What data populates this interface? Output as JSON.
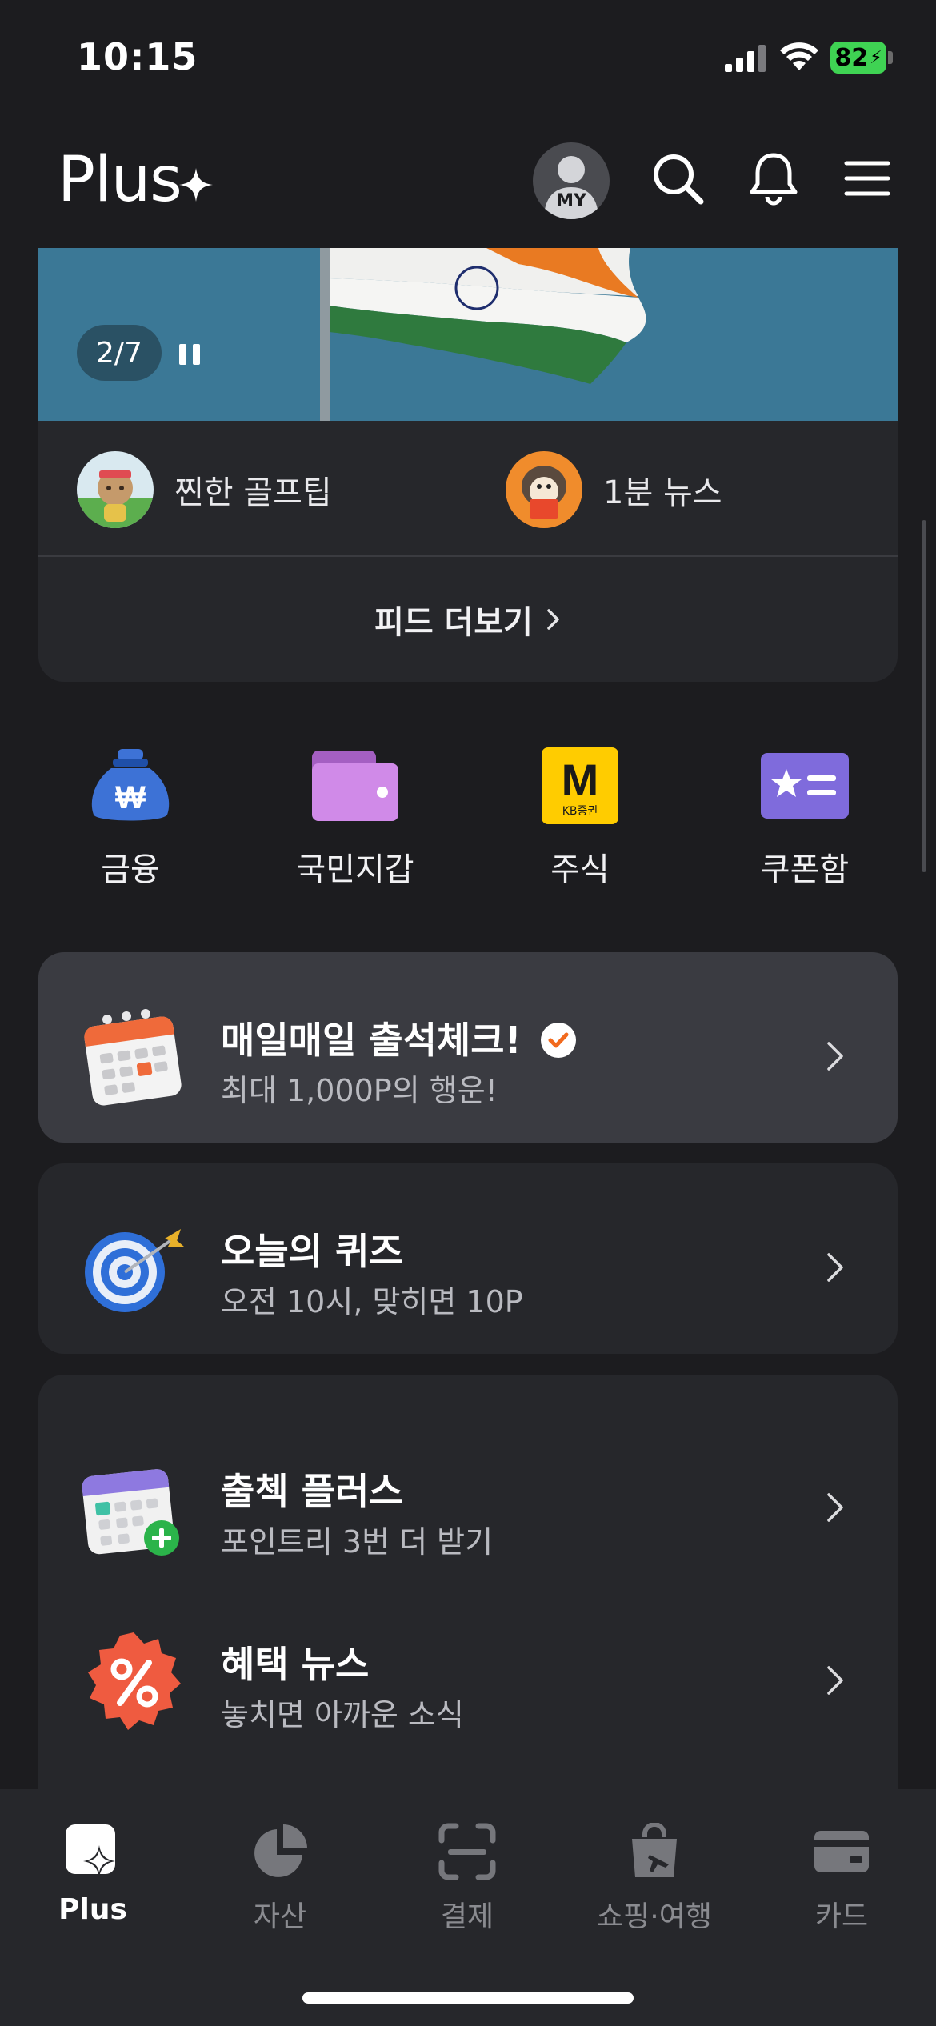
{
  "status_bar": {
    "time": "10:15",
    "battery": "82"
  },
  "header": {
    "logo": "Plus",
    "avatar_label": "MY"
  },
  "feed": {
    "pager": "2/7",
    "items": [
      {
        "label": "찐한 골프팁"
      },
      {
        "label": "1분 뉴스"
      }
    ],
    "more_label": "피드 더보기"
  },
  "quick_menu": [
    {
      "label": "금융"
    },
    {
      "label": "국민지갑"
    },
    {
      "label": "주식"
    },
    {
      "label": "쿠폰함"
    }
  ],
  "stock_icon_text": {
    "big": "M",
    "small": "KB증권"
  },
  "rows": {
    "attendance": {
      "title": "매일매일 출석체크!",
      "sub": "최대 1,000P의 행운!"
    },
    "quiz": {
      "title": "오늘의 퀴즈",
      "sub": "오전 10시, 맞히면 10P"
    },
    "checkplus": {
      "title": "출첵 플러스",
      "sub": "포인트리 3번 더 받기"
    },
    "benefit": {
      "title": "혜택 뉴스",
      "sub": "놓치면 아까운 소식"
    }
  },
  "tabs": [
    {
      "label": "Plus"
    },
    {
      "label": "자산"
    },
    {
      "label": "결제"
    },
    {
      "label": "쇼핑·여행"
    },
    {
      "label": "카드"
    }
  ],
  "colors": {
    "background": "#1c1c1f",
    "card": "#26272b",
    "highlight_card": "#3a3b41",
    "battery": "#3fd353",
    "accent_orange": "#f26a1e"
  }
}
